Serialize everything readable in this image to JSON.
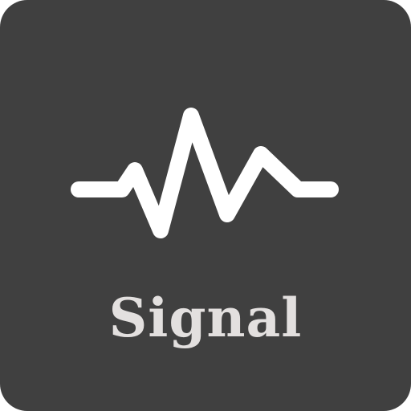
{
  "app": {
    "name": "Signal",
    "icon": "waveform-icon"
  },
  "colors": {
    "background": "#404040",
    "waveform": "#ffffff",
    "label": "#e3e0df"
  }
}
